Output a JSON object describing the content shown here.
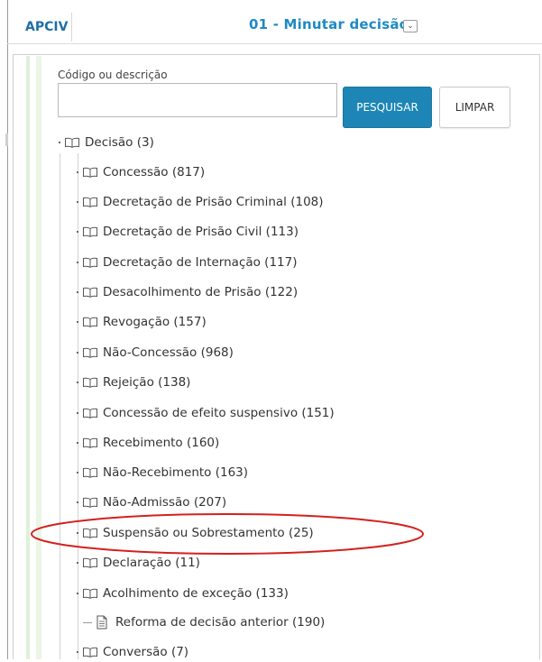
{
  "header": {
    "tab_label": "APCIV",
    "task_title": "01 - Minutar decisão",
    "dropdown_glyph": "⌄"
  },
  "search": {
    "label": "Código ou descrição",
    "value": "",
    "placeholder": "",
    "search_button": "PESQUISAR",
    "clear_button": "LIMPAR"
  },
  "colors": {
    "accent": "#1e86b6",
    "title": "#1f8ac4",
    "highlight": "#d42020",
    "guide_green": "#dff0d8"
  },
  "tree": {
    "root": {
      "label": "Decisão (3)",
      "icon": "book-icon"
    },
    "children": [
      {
        "label": "Concessão (817)",
        "icon": "book-icon"
      },
      {
        "label": "Decretação de Prisão Criminal (108)",
        "icon": "book-icon"
      },
      {
        "label": "Decretação de Prisão Civil (113)",
        "icon": "book-icon"
      },
      {
        "label": "Decretação de Internação (117)",
        "icon": "book-icon"
      },
      {
        "label": "Desacolhimento de Prisão (122)",
        "icon": "book-icon"
      },
      {
        "label": "Revogação (157)",
        "icon": "book-icon"
      },
      {
        "label": "Não-Concessão (968)",
        "icon": "book-icon"
      },
      {
        "label": "Rejeição (138)",
        "icon": "book-icon"
      },
      {
        "label": "Concessão de efeito suspensivo (151)",
        "icon": "book-icon"
      },
      {
        "label": "Recebimento (160)",
        "icon": "book-icon"
      },
      {
        "label": "Não-Recebimento (163)",
        "icon": "book-icon"
      },
      {
        "label": "Não-Admissão (207)",
        "icon": "book-icon"
      },
      {
        "label": "Suspensão ou Sobrestamento (25)",
        "icon": "book-icon",
        "highlighted": true
      },
      {
        "label": "Declaração (11)",
        "icon": "book-icon"
      },
      {
        "label": "Acolhimento de exceção (133)",
        "icon": "book-icon"
      },
      {
        "label": "Reforma de decisão anterior (190)",
        "icon": "document-icon"
      },
      {
        "label": "Conversão (7)",
        "icon": "book-icon"
      }
    ]
  }
}
